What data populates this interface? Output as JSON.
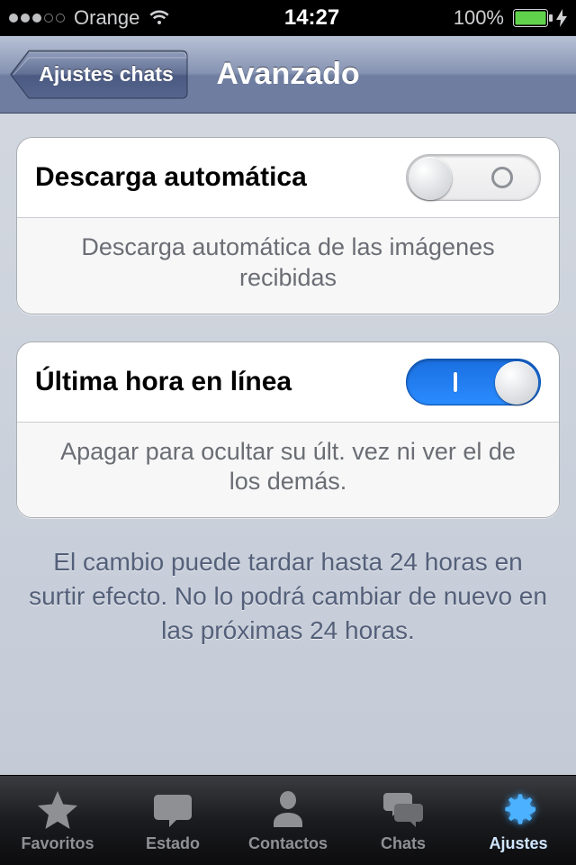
{
  "status": {
    "carrier": "Orange",
    "time": "14:27",
    "battery_pct": "100%"
  },
  "nav": {
    "back_label": "Ajustes chats",
    "title": "Avanzado"
  },
  "settings": {
    "auto_download": {
      "title": "Descarga automática",
      "desc": "Descarga automática de las imágenes recibidas",
      "on": false
    },
    "last_seen": {
      "title": "Última hora en línea",
      "desc": "Apagar para ocultar su últ. vez ni ver el de los demás.",
      "on": true
    },
    "footer_note": "El cambio puede tardar hasta 24 horas en surtir efecto. No lo podrá cambiar de nuevo en las próximas 24 horas."
  },
  "tabs": {
    "favorites": "Favoritos",
    "status": "Estado",
    "contacts": "Contactos",
    "chats": "Chats",
    "settings": "Ajustes",
    "active": "settings"
  }
}
